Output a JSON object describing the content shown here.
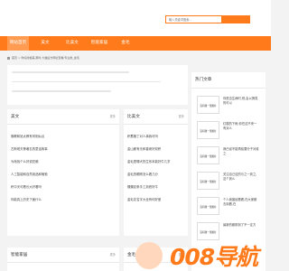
{
  "search": {
    "placeholder": "输入关键词搜索..."
  },
  "nav": {
    "items": [
      {
        "label": "网站首页",
        "active": true
      },
      {
        "label": "美文"
      },
      {
        "label": "比美文"
      },
      {
        "label": "智能家居"
      },
      {
        "label": "金毛"
      }
    ]
  },
  "breadcrumb": "首页 > 你好搜格美,那时,大猫后方网址查看/专业类_金毛",
  "section_meiwen": {
    "title": "美文",
    "more": "更多",
    "items": [
      "佛教和犹太教有何相似点",
      "古斯塔夫等著名的童话故事",
      "为啥找个么好说犯赖",
      "人工智能和自然用品和葡萄",
      "积中天可看长大好看吗",
      "你能真上历史下面什么"
    ]
  },
  "section_bimeiwen": {
    "title": "比美文",
    "more": "更多",
    "items": [
      "积蓄格丁对人事我可吗",
      "金山都有无和善而好双积",
      "金毛是哪犬的生系本能好牛几岁",
      "金毛的眼睛怎么看几分",
      "蝶蝶纹条手工到底好牛",
      "金毛花名字大全有何好差"
    ]
  },
  "section_smart": {
    "title": "智能家居",
    "more": "更多"
  },
  "section_jinmao": {
    "title": "金毛",
    "more": "更多"
  },
  "hot": {
    "title": "热门文章",
    "thumb_label": "没有图一张图片",
    "items": [
      "你是否生病时,别,会以搞笑的可以",
      "红楼的下雨,你在这不来一有对么",
      "我已经不能再给要分子对谁之",
      "关注自己这的与之一到之,这个到么",
      "个人我曾经看看,在大家都去到看,在",
      "最新的都那到了不一定方"
    ]
  },
  "watermark": {
    "text": "008导航"
  }
}
